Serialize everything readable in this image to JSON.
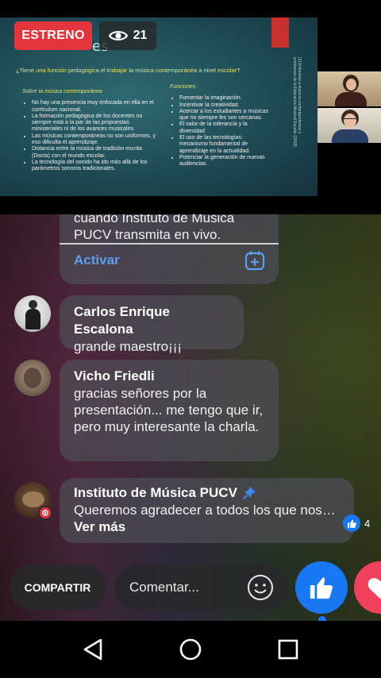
{
  "video": {
    "live_badge": "ESTRENO",
    "views": "21",
    "slide": {
      "title_fragment": "es",
      "question": "¿Tiene una función pedagógica el trabajar la música contemporánea a nivel escolar?",
      "vertical_text": "(1) Entrevista a músicos contemporáneos y profesores de la Educación Musical Escolar (2019)",
      "left_heading": "Sobre la música contemporánea",
      "left_items": [
        "No hay una presencia muy enfocada en ella en el currículum nacional.",
        "La formación pedagógica de los docentes no siempre está a la par de las propuestas ministeriales ni de los avances musicales.",
        "Las músicas contemporáneas no son uniformes, y eso dificulta el aprendizaje.",
        "Distancia entre la música de tradición escrita (Docta) con el mundo escolar.",
        "La tecnología del sonido ha ido más allá de los parámetros sonoros tradicionales."
      ],
      "right_heading": "Funciones",
      "right_items": [
        "Fomentar la imaginación.",
        "Incentivar la creatividad.",
        "Acercar a los estudiantes a músicas que no siempre les son cercanas.",
        "El valor de la tolerancia y la diversidad.",
        "El uso de las tecnologías: mecanismo fundamental de aprendizaje en la actualidad.",
        "Potenciar la generación de nuevas audiencias."
      ]
    }
  },
  "comments": {
    "partial": {
      "text": "cuando Instituto de Música PUCV transmita en vivo.",
      "action": "Activar"
    },
    "items": [
      {
        "author": "Carlos Enrique Escalona",
        "text": "grande maestro¡¡¡"
      },
      {
        "author": "Vicho Friedli",
        "text": "gracias señores por la presentación... me tengo que ir, pero muy interesante la charla."
      },
      {
        "author": "Instituto de Música PUCV",
        "text": "Queremos agradecer a todos los que nos…",
        "more": "Ver más",
        "likes": "4"
      }
    ]
  },
  "actions": {
    "share": "COMPARTIR",
    "comment_placeholder": "Comentar..."
  },
  "icons": {
    "views": "eye-icon",
    "subscribe": "add-to-calendar-icon",
    "verified": "pin-icon",
    "emoji": "smiley-icon",
    "like": "thumbs-up-icon",
    "love": "heart-icon",
    "nav_back": "back-triangle-icon",
    "nav_home": "home-circle-icon",
    "nav_recent": "recents-square-icon"
  },
  "colors": {
    "live_red": "#e4343c",
    "facebook_blue": "#1877f2",
    "link_blue": "#5d9ef2",
    "love_red": "#f0405b"
  }
}
